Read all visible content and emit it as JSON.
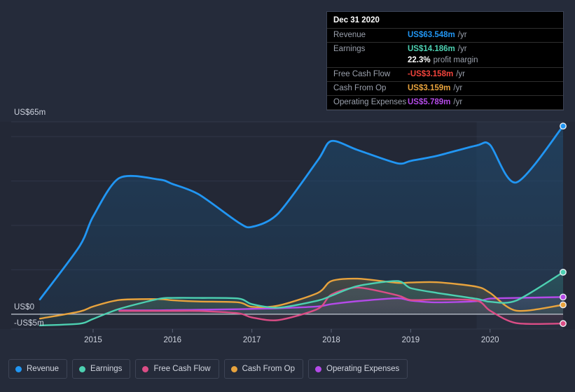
{
  "theme": {
    "background": "#252b3a",
    "grid_color": "#39405120",
    "zero_line_color": "#9aa0ac",
    "tooltip_bg": "#000000"
  },
  "axes": {
    "y_labels": [
      "US$65m",
      "US$0",
      "-US$5m"
    ],
    "y_top_value": 65,
    "y_zero_value": 0,
    "y_bottom_value": -5,
    "x_labels": [
      "2015",
      "2016",
      "2017",
      "2018",
      "2019",
      "2020"
    ]
  },
  "tooltip": {
    "date": "Dec 31 2020",
    "rows": [
      {
        "label": "Revenue",
        "value": "US$63.548m",
        "unit": "/yr",
        "color": "#2196f3"
      },
      {
        "label": "Earnings",
        "value": "US$14.186m",
        "unit": "/yr",
        "color": "#4dd0b1"
      },
      {
        "label": "",
        "value": "22.3%",
        "unit": "profit margin",
        "color": "#ffffff"
      },
      {
        "label": "Free Cash Flow",
        "value": "-US$3.158m",
        "unit": "/yr",
        "color": "#f4443c"
      },
      {
        "label": "Cash From Op",
        "value": "US$3.159m",
        "unit": "/yr",
        "color": "#e8a33d"
      },
      {
        "label": "Operating Expenses",
        "value": "US$5.789m",
        "unit": "/yr",
        "color": "#b44ae8"
      }
    ]
  },
  "legend": [
    {
      "label": "Revenue",
      "color": "#2196f3"
    },
    {
      "label": "Earnings",
      "color": "#4dd0b1"
    },
    {
      "label": "Free Cash Flow",
      "color": "#db4d86"
    },
    {
      "label": "Cash From Op",
      "color": "#e8a33d"
    },
    {
      "label": "Operating Expenses",
      "color": "#b44ae8"
    }
  ],
  "chart_data": {
    "type": "area",
    "title": "",
    "xlabel": "",
    "ylabel": "US$m",
    "ylim": [
      -5,
      65
    ],
    "xlim": [
      2014.33,
      2020.92
    ],
    "grid": true,
    "legend_position": "bottom",
    "currency": "USD",
    "units": "millions per year",
    "x": [
      2014.33,
      2014.83,
      2015.0,
      2015.33,
      2015.83,
      2016.0,
      2016.33,
      2016.83,
      2017.0,
      2017.33,
      2017.83,
      2018.0,
      2018.33,
      2018.83,
      2019.0,
      2019.33,
      2019.83,
      2020.0,
      2020.33,
      2020.92
    ],
    "series": [
      {
        "name": "Revenue",
        "color": "#2196f3",
        "fill": "#1c4a70",
        "values": [
          5.0,
          23.0,
          33.0,
          46.0,
          45.5,
          44.0,
          40.5,
          31.0,
          29.5,
          34.0,
          52.0,
          58.5,
          55.5,
          51.0,
          51.8,
          53.5,
          57.0,
          57.2,
          44.5,
          63.548
        ]
      },
      {
        "name": "Earnings",
        "color": "#4dd0b1",
        "fill": "#2f6a68",
        "values": [
          -3.8,
          -3.2,
          -1.6,
          1.8,
          5.2,
          5.5,
          5.5,
          5.3,
          3.4,
          2.2,
          4.6,
          6.2,
          9.5,
          11.2,
          8.8,
          7.2,
          5.2,
          4.2,
          4.6,
          14.186
        ]
      },
      {
        "name": "Free Cash Flow",
        "color": "#db4d86",
        "fill": "#6e3a52",
        "values": [
          null,
          null,
          null,
          1.1,
          1.1,
          1.1,
          1.1,
          0.3,
          -1.1,
          -2.0,
          1.8,
          6.6,
          9.0,
          6.4,
          4.8,
          5.0,
          4.6,
          1.2,
          -3.0,
          -3.158
        ]
      },
      {
        "name": "Cash From Op",
        "color": "#e8a33d",
        "fill": "#6c6242",
        "values": [
          -1.5,
          0.9,
          2.6,
          4.8,
          5.1,
          4.7,
          4.3,
          4.0,
          2.5,
          2.9,
          7.2,
          11.2,
          12.0,
          10.6,
          10.7,
          10.8,
          9.3,
          7.2,
          1.2,
          3.159
        ]
      },
      {
        "name": "Operating Expenses",
        "color": "#b44ae8",
        "fill": "#5a3d7a",
        "values": [
          null,
          null,
          null,
          1.3,
          1.3,
          1.4,
          1.5,
          1.7,
          1.8,
          2.0,
          2.6,
          3.4,
          4.4,
          5.4,
          4.6,
          4.0,
          4.4,
          5.3,
          5.5,
          5.789
        ]
      }
    ],
    "highlight_region": {
      "from_x": 2019.83,
      "to_x": 2020.92,
      "label": ""
    }
  }
}
